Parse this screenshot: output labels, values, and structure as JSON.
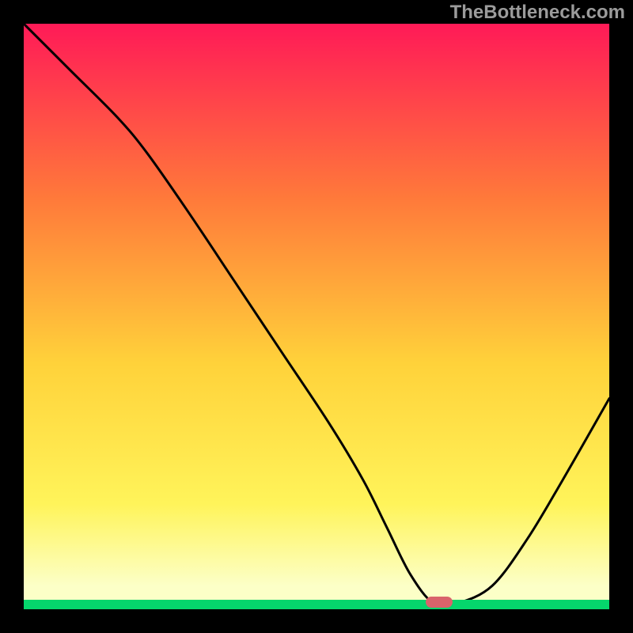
{
  "watermark": "TheBottleneck.com",
  "colors": {
    "gradient_top": "#ff1a57",
    "gradient_mid1": "#ff7a3a",
    "gradient_mid2": "#ffd23a",
    "gradient_mid3": "#fff45a",
    "gradient_bottom": "#fcffc7",
    "green_band": "#05d66c",
    "curve": "#000000",
    "highlight": "#d9636b",
    "frame": "#000000"
  },
  "chart_data": {
    "type": "line",
    "title": "",
    "xlabel": "",
    "ylabel": "",
    "xlim": [
      0,
      100
    ],
    "ylim": [
      0,
      100
    ],
    "x": [
      0,
      8,
      16,
      21,
      28,
      36,
      44,
      52,
      58,
      62,
      66,
      70,
      74,
      80,
      86,
      92,
      100
    ],
    "y": [
      100,
      92,
      84,
      78,
      68,
      56,
      44,
      32,
      22,
      14,
      6,
      1,
      1,
      4,
      12,
      22,
      36
    ],
    "annotations": [
      {
        "kind": "highlight",
        "x": 71,
        "y": 0,
        "color": "#d9636b"
      }
    ]
  }
}
